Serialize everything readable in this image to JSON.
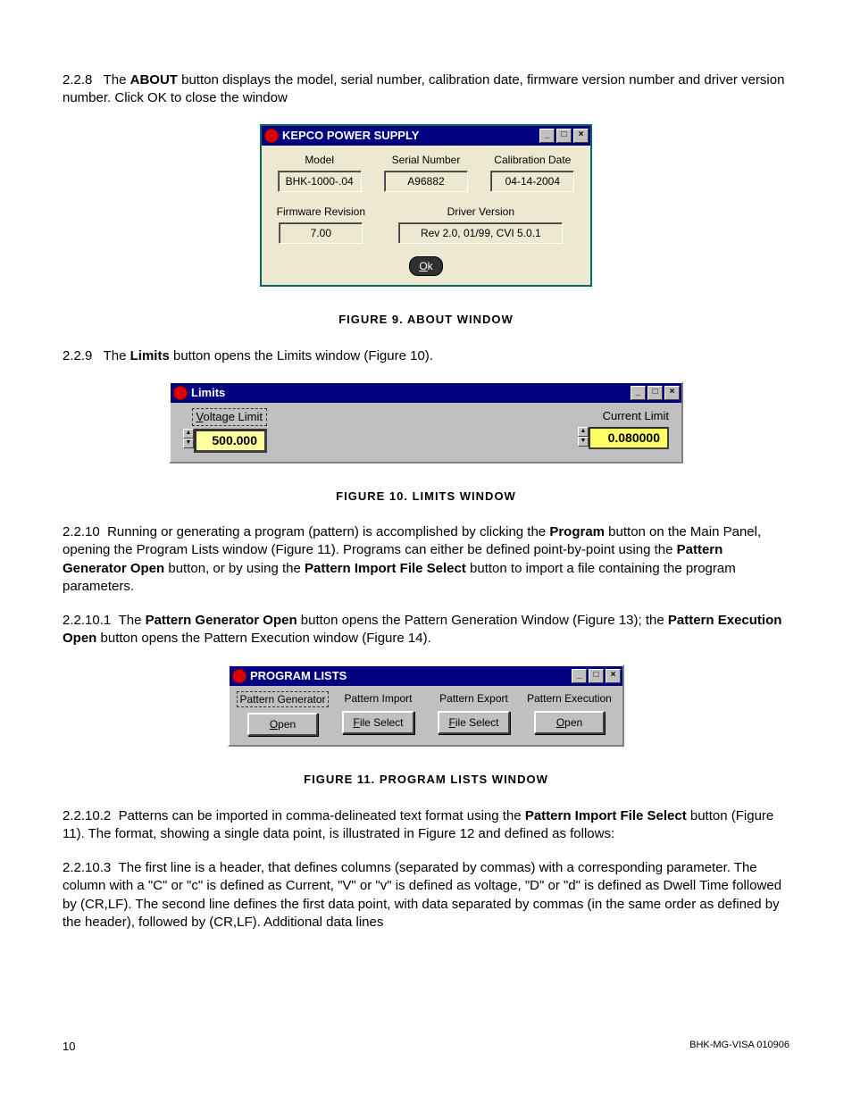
{
  "para228": {
    "num": "2.2.8",
    "pre": "The ",
    "bold": "ABOUT",
    "post": " button displays the model, serial number, calibration date, firmware version number and driver version number. Click OK to close the window"
  },
  "about": {
    "title": "KEPCO POWER SUPPLY",
    "model_label": "Model",
    "model_value": "BHK-1000-.04",
    "serial_label": "Serial Number",
    "serial_value": "A96882",
    "caldate_label": "Calibration Date",
    "caldate_value": "04-14-2004",
    "fw_label": "Firmware Revision",
    "fw_value": "7.00",
    "drv_label": "Driver Version",
    "drv_value": "Rev 2.0, 01/99, CVI 5.0.1",
    "ok_u": "O",
    "ok_rest": "k"
  },
  "fig9": "FIGURE 9.    ABOUT WINDOW",
  "para229": {
    "num": "2.2.9",
    "pre": "The ",
    "bold": "Limits",
    "post": " button opens the Limits window (Figure 10)."
  },
  "limits": {
    "title": "Limits",
    "vlabel_u": "V",
    "vlabel_rest": "oltage Limit",
    "vvalue": "500.000",
    "clabel": "Current Limit",
    "cvalue": "0.080000"
  },
  "fig10": "FIGURE 10.    LIMITS WINDOW",
  "para2210": {
    "num": "2.2.10",
    "p1": "Running or generating a program (pattern) is accomplished by clicking the ",
    "b1": "Program",
    "p2": " button on the Main Panel, opening the Program Lists window (Figure 11). Programs can either be defined point-by-point using the ",
    "b2": "Pattern Generator Open",
    "p3": " button, or by using the ",
    "b3": "Pattern Import File Select",
    "p4": " button to import a file containing the program parameters."
  },
  "para22101": {
    "num": "2.2.10.1",
    "p1": "The ",
    "b1": "Pattern Generator Open",
    "p2": " button opens the Pattern Generation Window (Figure 13); the ",
    "b2": "Pattern Execution Open",
    "p3": " button opens the Pattern Execution window (Figure 14)."
  },
  "prog": {
    "title": "PROGRAM LISTS",
    "c1": "Pattern Generator",
    "c2": "Pattern Import",
    "c3": "Pattern Export",
    "c4": "Pattern Execution",
    "b1_u": "O",
    "b1_r": "pen",
    "b2_u": "F",
    "b2_r": "ile Select",
    "b3_u": "F",
    "b3_r": "ile Select",
    "b4_u": "O",
    "b4_r": "pen"
  },
  "fig11": "FIGURE 11.    PROGRAM LISTS WINDOW",
  "para22102": {
    "num": "2.2.10.2",
    "p1": "Patterns can be imported in comma-delineated text format using the ",
    "b1": "Pattern Import File Select",
    "p2": " button (Figure 11). The format, showing a single data point, is illustrated in Figure 12 and defined as follows:"
  },
  "para22103": {
    "num": "2.2.10.3",
    "t": "The first line is a header, that defines columns (separated by commas) with a corresponding parameter. The column with a \"C\" or \"c\" is defined as Current, \"V\" or \"v\" is defined as voltage, \"D\" or \"d\" is defined as Dwell Time followed by (CR,LF). The second line defines the first data point, with data separated by commas (in the same order as defined by the header), followed by (CR,LF). Additional data lines"
  },
  "footer": {
    "page": "10",
    "doc": "BHK-MG-VISA 010906"
  }
}
